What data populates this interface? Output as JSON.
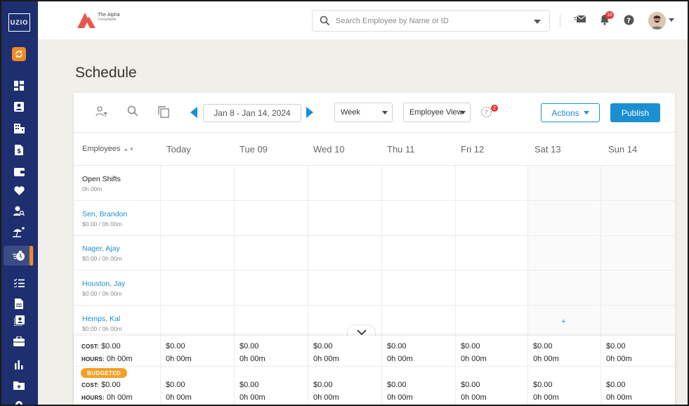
{
  "app": {
    "logo_text": "UZIO",
    "brand_line1": "The Alpha",
    "brand_line2": "Consultants"
  },
  "search": {
    "placeholder": "Search Employee by Name or ID"
  },
  "notifications": {
    "count": "10"
  },
  "page": {
    "title": "Schedule"
  },
  "toolbar": {
    "date_range": "Jan 8 - Jan 14, 2024",
    "view_select": "Week",
    "mode_select": "Employee View",
    "help_badge": "2",
    "actions_label": "Actions",
    "publish_label": "Publish"
  },
  "grid": {
    "employees_header": "Employees",
    "days": [
      "Today",
      "Tue 09",
      "Wed 10",
      "Thu 11",
      "Fri 12",
      "Sat 13",
      "Sun 14"
    ],
    "rows": [
      {
        "name": "Open Shifts",
        "sub": "0h 00m"
      },
      {
        "name": "Sen, Brandon",
        "sub": "$0.00 / 0h 00m"
      },
      {
        "name": "Nager, Ajay",
        "sub": "$0.00 / 0h 00m"
      },
      {
        "name": "Houston, Jay",
        "sub": "$0.00 / 0h 00m"
      },
      {
        "name": "Hemps, Kal",
        "sub": "$0.00 / 0h 00m"
      }
    ],
    "plus": "+"
  },
  "summary": {
    "cost_label": "COST:",
    "hours_label": "HOURS:",
    "budgeted_label": "BUDGETED",
    "actual": {
      "cost": "$0.00",
      "hours": "0h 00m",
      "day_cost": "$0.00",
      "day_hours": "0h 00m"
    },
    "budgeted": {
      "cost": "$0.00",
      "hours": "0h 00m",
      "day_cost": "$0.00",
      "day_hours": "0h 00m"
    }
  },
  "colors": {
    "sidebar": "#1d2f6f",
    "accent": "#1a8fd1",
    "orange": "#f08a24",
    "budget": "#f4a025"
  }
}
